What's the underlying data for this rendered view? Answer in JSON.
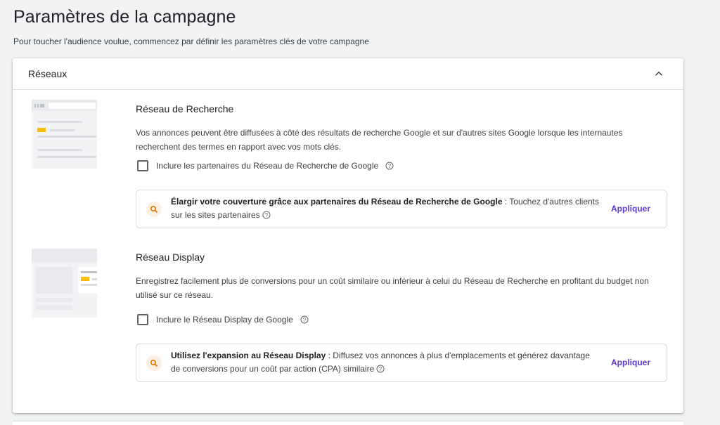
{
  "page": {
    "title": "Paramètres de la campagne",
    "subtitle": "Pour toucher l'audience voulue, commencez par définir les paramètres clés de votre campagne"
  },
  "networks_card": {
    "header": "Réseaux",
    "search": {
      "title": "Réseau de Recherche",
      "description": "Vos annonces peuvent être diffusées à côté des résultats de recherche Google et sur d'autres sites Google lorsque les internautes recherchent des termes en rapport avec vos mots clés.",
      "checkbox_label": "Inclure les partenaires du Réseau de Recherche de Google",
      "checkbox_checked": false,
      "reco_bold": "Élargir votre couverture grâce aux partenaires du Réseau de Recherche de Google",
      "reco_text": " : Touchez d'autres clients sur les sites partenaires",
      "apply_label": "Appliquer"
    },
    "display": {
      "title": "Réseau Display",
      "description": "Enregistrez facilement plus de conversions pour un coût similaire ou inférieur à celui du Réseau de Recherche en profitant du budget non utilisé sur ce réseau.",
      "checkbox_label": "Inclure le Réseau Display de Google",
      "checkbox_checked": false,
      "reco_bold": "Utilisez l'expansion au Réseau Display",
      "reco_text": " : Diffusez vos annonces à plus d'emplacements et générez davantage de conversions pour un coût par action (CPA) similaire",
      "apply_label": "Appliquer"
    }
  },
  "colors": {
    "accent": "#5e35d6",
    "illustration_highlight": "#fbbc04",
    "reco_icon_bg": "#feefe3",
    "reco_icon_fg": "#e37400"
  }
}
